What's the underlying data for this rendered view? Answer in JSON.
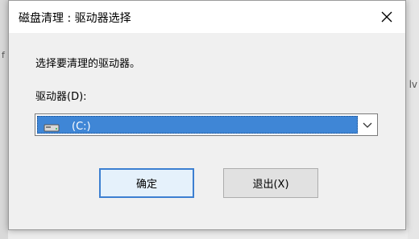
{
  "dialog": {
    "title": "磁盘清理 : 驱动器选择",
    "prompt": "选择要清理的驱动器。",
    "drive_label": "驱动器(D):",
    "selected_drive": "(C:)",
    "ok_label": "确定",
    "exit_label": "退出(X)"
  },
  "background": {
    "left_glyph": "f",
    "right_glyph": "lv"
  },
  "colors": {
    "selection": "#3f86d6",
    "default_button_border": "#3c7fd1"
  },
  "icons": {
    "close": "close-icon",
    "drive": "hard-drive-icon",
    "dropdown": "chevron-down-icon"
  }
}
